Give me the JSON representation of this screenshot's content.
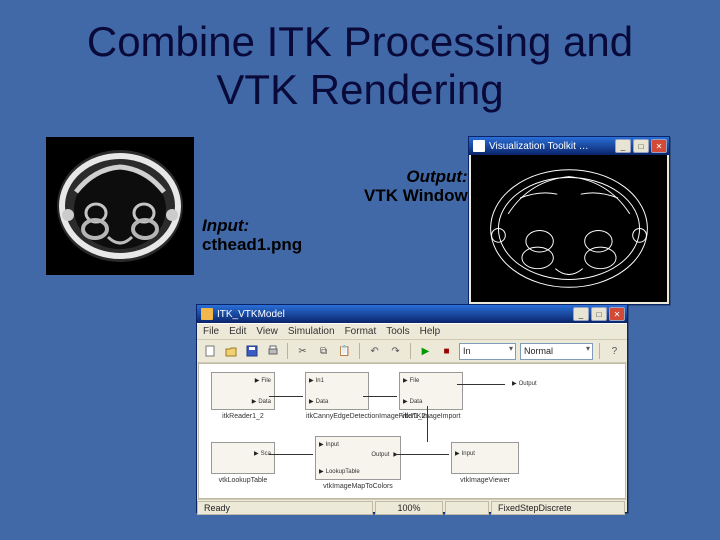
{
  "title_line1": "Combine ITK Processing and",
  "title_line2": "VTK Rendering",
  "input_label": {
    "head": "Input:",
    "body": "cthead1.png"
  },
  "output_label": {
    "head": "Output:",
    "body": "VTK Window"
  },
  "vtk_window": {
    "caption": "Visualization Toolkit …",
    "min": "_",
    "max": "□",
    "close": "✕"
  },
  "model_window": {
    "caption": "ITK_VTKModel",
    "menus": [
      "File",
      "Edit",
      "View",
      "Simulation",
      "Format",
      "Tools",
      "Help"
    ],
    "toolbar": {
      "dropdown1": "In",
      "dropdown2": "Normal"
    },
    "nodes": {
      "reader": {
        "p1": "File",
        "p2": "Data",
        "label": "itkReader1_2"
      },
      "canny": {
        "p1": "In1",
        "p2": "Data",
        "label": "itkCannyEdgeDetectionImageFilter1_2"
      },
      "export": {
        "p1": "File",
        "p2": "Data",
        "label": "vtkITKImageImport"
      },
      "outport": {
        "p1": "Output"
      },
      "scalar": {
        "p1": "Sca",
        "label": "vtkLookupTable"
      },
      "lookup": {
        "p1": "Input",
        "p2": "LookupTable",
        "p3": "Output",
        "label": "vtkImageMapToColors"
      },
      "viewer": {
        "p1": "Input",
        "label": "vtkImageViewer"
      }
    },
    "status": {
      "ready": "Ready",
      "zoom": "100%",
      "mode": "FixedStepDiscrete"
    }
  }
}
